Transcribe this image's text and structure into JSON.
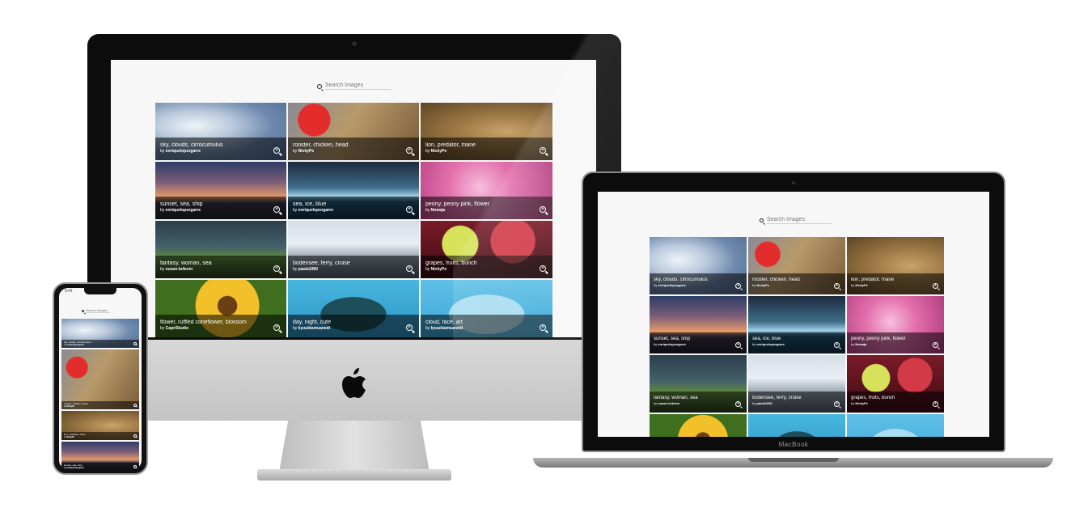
{
  "search": {
    "placeholder": "Search Images"
  },
  "images": [
    {
      "tags": "sky, clouds, cirrocumulus",
      "by_prefix": "by",
      "author": "enriquelopezgarre",
      "theme": "img-sky"
    },
    {
      "tags": "rooster, chicken, head",
      "by_prefix": "by",
      "author": "NickyPe",
      "theme": "img-rooster"
    },
    {
      "tags": "lion, predator, mane",
      "by_prefix": "by",
      "author": "NickyPe",
      "theme": "img-lion"
    },
    {
      "tags": "sunset, sea, ship",
      "by_prefix": "by",
      "author": "enriquelopezgarre",
      "theme": "img-sunset"
    },
    {
      "tags": "sea, ice, blue",
      "by_prefix": "by",
      "author": "enriquelopezgarre",
      "theme": "img-ice"
    },
    {
      "tags": "peony, peony pink, flower",
      "by_prefix": "by",
      "author": "Nowaja",
      "theme": "img-peony"
    },
    {
      "tags": "fantasy, woman, sea",
      "by_prefix": "by",
      "author": "susan-lu4esm",
      "theme": "img-fantasy"
    },
    {
      "tags": "bodensee, ferry, cruise",
      "by_prefix": "by",
      "author": "paula1080",
      "theme": "img-ferry"
    },
    {
      "tags": "grapes, fruits, bunch",
      "by_prefix": "by",
      "author": "NickyPe",
      "theme": "img-grapes"
    },
    {
      "tags": "flower, ruffled coneflower, blossom",
      "by_prefix": "by",
      "author": "CapriStudio",
      "theme": "img-flower"
    },
    {
      "tags": "day, night, cute",
      "by_prefix": "by",
      "author": "kyuubiamuanedi",
      "theme": "img-night"
    },
    {
      "tags": "cloud, face, art",
      "by_prefix": "by",
      "author": "kyuubiamuanedi",
      "theme": "img-cloud"
    }
  ],
  "devices": {
    "laptop_brand": "MacBook",
    "phone_time": "9:41"
  },
  "colors": {
    "screen_bg": "#f7f7f7",
    "caption_overlay": "rgba(0,0,0,0.55)"
  }
}
